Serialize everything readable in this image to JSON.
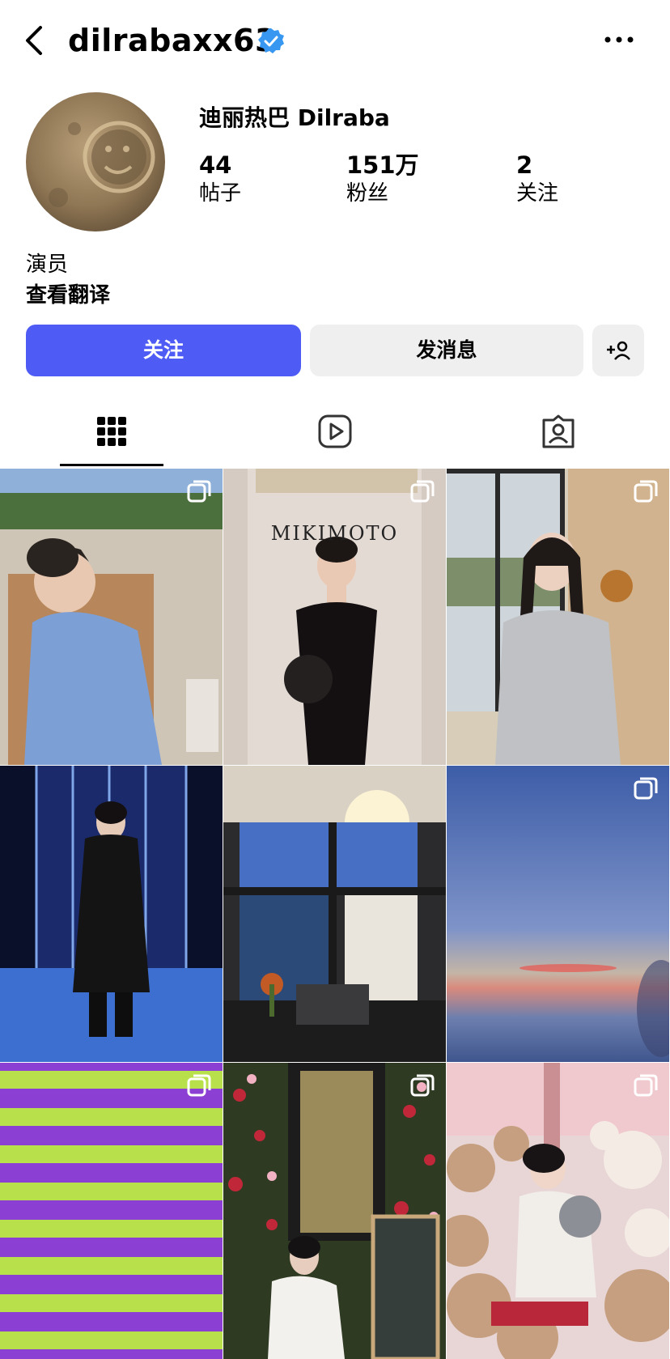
{
  "header": {
    "username": "dilrabaxx63",
    "back_icon": "chevron-left-icon",
    "verified_icon": "verified-badge-icon",
    "more_icon": "more-horizontal-icon",
    "verified_color": "#3897f0"
  },
  "profile": {
    "display_name": "迪丽热巴 Dilraba",
    "stats": [
      {
        "value": "44",
        "label": "帖子"
      },
      {
        "value": "151万",
        "label": "粉丝"
      },
      {
        "value": "2",
        "label": "关注"
      }
    ],
    "bio": "演员",
    "translate_label": "查看翻译"
  },
  "actions": {
    "follow_label": "关注",
    "message_label": "发消息",
    "add_user_icon": "add-user-icon",
    "follow_color": "#4f5bf5"
  },
  "tabs": [
    {
      "icon": "grid-icon",
      "active": true
    },
    {
      "icon": "reels-icon",
      "active": false
    },
    {
      "icon": "tagged-icon",
      "active": false
    }
  ],
  "posts": [
    {
      "caption": "",
      "multi": true
    },
    {
      "caption": "MIKIMOTO",
      "multi": true
    },
    {
      "caption": "",
      "multi": true
    },
    {
      "caption": "",
      "multi": false
    },
    {
      "caption": "",
      "multi": false
    },
    {
      "caption": "",
      "multi": true
    },
    {
      "caption": "",
      "multi": true
    },
    {
      "caption": "",
      "multi": true
    },
    {
      "caption": "",
      "multi": true
    }
  ]
}
